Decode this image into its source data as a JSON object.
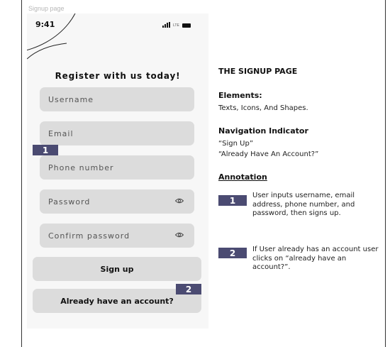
{
  "frame_label": "Signup page",
  "status_bar": {
    "time": "9:41",
    "network": "LTE"
  },
  "signup": {
    "title": "Register with us today!",
    "fields": {
      "username": "Username",
      "email": "Email",
      "phone": "Phone number",
      "password": "Password",
      "confirm_password": "Confirm password"
    },
    "signup_button": "Sign up",
    "login_link": "Already have an account?"
  },
  "badges": {
    "one": "1",
    "two": "2"
  },
  "panel": {
    "title": "THE SIGNUP PAGE",
    "elements_heading": "Elements:",
    "elements_text": "Texts, Icons, And Shapes.",
    "nav_heading": "Navigation Indicator",
    "nav_items": [
      "“Sign Up”",
      "“Already Have An Account?”"
    ],
    "annotation_heading": "Annotation",
    "annotations": [
      "User inputs username, email address, phone number, and password, then signs up.",
      "If User already has an account user clicks on “already have an account?”."
    ]
  },
  "colors": {
    "badge": "#4b4b72",
    "field": "#dcdcdc",
    "phone_bg": "#f7f7f7"
  }
}
